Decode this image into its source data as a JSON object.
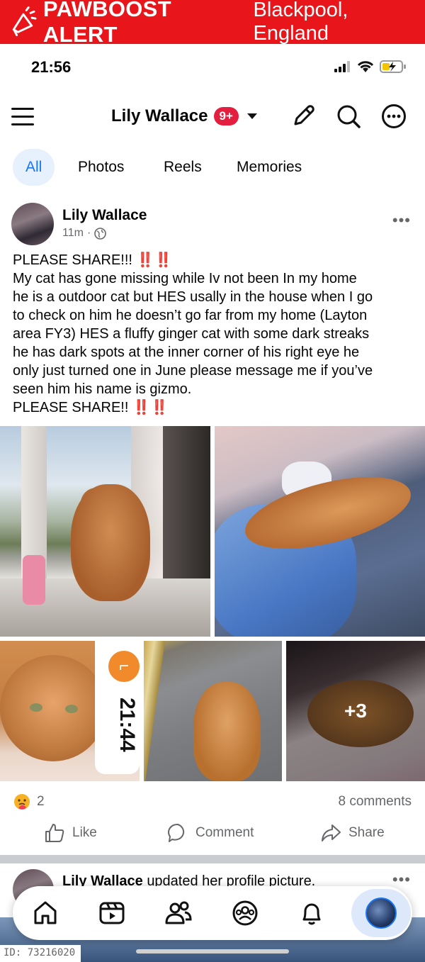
{
  "alert": {
    "brand": "PAWBOOST ALERT",
    "location": "Blackpool, England",
    "color": "#e8151b"
  },
  "status_bar": {
    "time": "21:56"
  },
  "header": {
    "title": "Lily Wallace",
    "badge": "9+",
    "icons": [
      "menu-icon",
      "pencil-icon",
      "search-icon",
      "more-icon"
    ]
  },
  "tabs": [
    {
      "label": "All",
      "active": true
    },
    {
      "label": "Photos"
    },
    {
      "label": "Reels"
    },
    {
      "label": "Memories"
    }
  ],
  "post": {
    "author": "Lily Wallace",
    "time": "11m",
    "lines": [
      "PLEASE SHARE!!!",
      "My cat has gone missing while Iv not been In my home",
      "he is a outdoor cat but HES usally in the house when I go",
      "to check on him he doesn’t go far from my home (Layton",
      "area FY3) HES a fluffy ginger cat with some dark streaks",
      "he has dark spots at the inner corner of his right eye he",
      "only just turned one in June please message me if you’ve",
      "seen him his name is gizmo.",
      "PLEASE SHARE!!"
    ],
    "emphasis": "‼️‼️",
    "photo_clock_time": "21:44",
    "more_photos": "+3",
    "reaction_count": "2",
    "comments": "8 comments",
    "actions": {
      "like": "Like",
      "comment": "Comment",
      "share": "Share"
    }
  },
  "post2": {
    "author": "Lily Wallace",
    "text": "updated her profile picture."
  },
  "nav": [
    "home-icon",
    "video-icon",
    "friends-icon",
    "groups-icon",
    "bell-icon",
    "profile-avatar"
  ],
  "footer": {
    "id": "ID: 73216020"
  },
  "colors": {
    "accent": "#1877f2",
    "badge": "#e41e3f"
  }
}
